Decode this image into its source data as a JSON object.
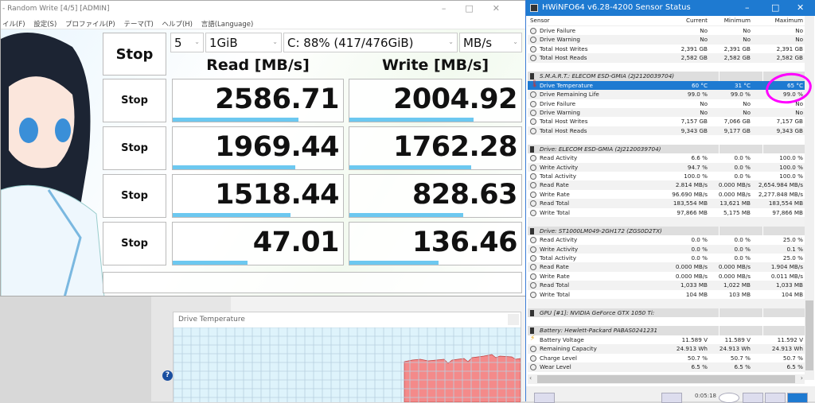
{
  "cdm": {
    "title": "- Random Write [4/5] [ADMIN]",
    "window_controls": [
      "–",
      "□",
      "✕"
    ],
    "menu": [
      "イル(F)",
      "設定(S)",
      "プロファイル(P)",
      "テーマ(T)",
      "ヘルプ(H)",
      "言語(Language)"
    ],
    "all_button": "Stop",
    "count": "5",
    "size": "1GiB",
    "drive": "C: 88% (417/476GiB)",
    "unit": "MB/s",
    "read_header": "Read [MB/s]",
    "write_header": "Write [MB/s]",
    "rows": [
      {
        "button": "Stop",
        "read": "2586.71",
        "write": "2004.92",
        "read_fill": 0.74,
        "write_fill": 0.72
      },
      {
        "button": "Stop",
        "read": "1969.44",
        "write": "1762.28",
        "read_fill": 0.72,
        "write_fill": 0.71
      },
      {
        "button": "Stop",
        "read": "1518.44",
        "write": "828.63",
        "read_fill": 0.69,
        "write_fill": 0.66
      },
      {
        "button": "Stop",
        "read": "47.01",
        "write": "136.46",
        "read_fill": 0.44,
        "write_fill": 0.52
      }
    ],
    "comment": ""
  },
  "temp_window": {
    "title": "Drive Temperature",
    "fill_color": "#f48a8a",
    "grid_color": "#b8d0e0",
    "bg_color": "#def3fb"
  },
  "hwinfo": {
    "title": "HWiNFO64 v6.28-4200 Sensor Status",
    "accent": "#1e7ad1",
    "highlight_color": "#ff00ff",
    "columns": [
      "Sensor",
      "Current",
      "Minimum",
      "Maximum"
    ],
    "rows": [
      {
        "type": "data",
        "name": "Drive Failure",
        "cur": "No",
        "min": "No",
        "max": "No"
      },
      {
        "type": "data",
        "name": "Drive Warning",
        "cur": "No",
        "min": "No",
        "max": "No"
      },
      {
        "type": "data",
        "name": "Total Host Writes",
        "cur": "2,391 GB",
        "min": "2,391 GB",
        "max": "2,391 GB"
      },
      {
        "type": "data",
        "name": "Total Host Reads",
        "cur": "2,582 GB",
        "min": "2,582 GB",
        "max": "2,582 GB"
      },
      {
        "type": "blank"
      },
      {
        "type": "group",
        "name": "S.M.A.R.T.: ELECOM ESD-GMIA (2J2120039704)"
      },
      {
        "type": "sel",
        "name": "Drive Temperature",
        "cur": "60 °C",
        "min": "31 °C",
        "max": "65 °C"
      },
      {
        "type": "data",
        "name": "Drive Remaining Life",
        "cur": "99.0 %",
        "min": "99.0 %",
        "max": "99.0 %"
      },
      {
        "type": "data",
        "name": "Drive Failure",
        "cur": "No",
        "min": "No",
        "max": "No"
      },
      {
        "type": "data",
        "name": "Drive Warning",
        "cur": "No",
        "min": "No",
        "max": "No"
      },
      {
        "type": "data",
        "name": "Total Host Writes",
        "cur": "7,157 GB",
        "min": "7,066 GB",
        "max": "7,157 GB"
      },
      {
        "type": "data",
        "name": "Total Host Reads",
        "cur": "9,343 GB",
        "min": "9,177 GB",
        "max": "9,343 GB"
      },
      {
        "type": "blank"
      },
      {
        "type": "group",
        "name": "Drive: ELECOM ESD-GMIA (2J2120039704)"
      },
      {
        "type": "data",
        "name": "Read Activity",
        "cur": "6.6 %",
        "min": "0.0 %",
        "max": "100.0 %"
      },
      {
        "type": "data",
        "name": "Write Activity",
        "cur": "94.7 %",
        "min": "0.0 %",
        "max": "100.0 %"
      },
      {
        "type": "data",
        "name": "Total Activity",
        "cur": "100.0 %",
        "min": "0.0 %",
        "max": "100.0 %"
      },
      {
        "type": "data",
        "name": "Read Rate",
        "cur": "2.814 MB/s",
        "min": "0.000 MB/s",
        "max": "2,654.984 MB/s"
      },
      {
        "type": "data",
        "name": "Write Rate",
        "cur": "96.690 MB/s",
        "min": "0.000 MB/s",
        "max": "2,277.848 MB/s"
      },
      {
        "type": "data",
        "name": "Read Total",
        "cur": "183,554 MB",
        "min": "13,621 MB",
        "max": "183,554 MB"
      },
      {
        "type": "data",
        "name": "Write Total",
        "cur": "97,866 MB",
        "min": "5,175 MB",
        "max": "97,866 MB"
      },
      {
        "type": "blank"
      },
      {
        "type": "group",
        "name": "Drive: ST1000LM049-2GH172 (ZGS0D2TX)"
      },
      {
        "type": "data",
        "name": "Read Activity",
        "cur": "0.0 %",
        "min": "0.0 %",
        "max": "25.0 %"
      },
      {
        "type": "data",
        "name": "Write Activity",
        "cur": "0.0 %",
        "min": "0.0 %",
        "max": "0.1 %"
      },
      {
        "type": "data",
        "name": "Total Activity",
        "cur": "0.0 %",
        "min": "0.0 %",
        "max": "25.0 %"
      },
      {
        "type": "data",
        "name": "Read Rate",
        "cur": "0.000 MB/s",
        "min": "0.000 MB/s",
        "max": "1.904 MB/s"
      },
      {
        "type": "data",
        "name": "Write Rate",
        "cur": "0.000 MB/s",
        "min": "0.000 MB/s",
        "max": "0.011 MB/s"
      },
      {
        "type": "data",
        "name": "Read Total",
        "cur": "1,033 MB",
        "min": "1,022 MB",
        "max": "1,033 MB"
      },
      {
        "type": "data",
        "name": "Write Total",
        "cur": "104 MB",
        "min": "103 MB",
        "max": "104 MB"
      },
      {
        "type": "blank"
      },
      {
        "type": "group",
        "name": "GPU [#1]: NVIDIA GeForce GTX 1050 Ti:"
      },
      {
        "type": "blank"
      },
      {
        "type": "group",
        "name": "Battery: Hewlett-Packard  PABAS0241231"
      },
      {
        "type": "bat",
        "name": "Battery Voltage",
        "cur": "11.589 V",
        "min": "11.589 V",
        "max": "11.592 V"
      },
      {
        "type": "data",
        "name": "Remaining Capacity",
        "cur": "24.913 Wh",
        "min": "24.913 Wh",
        "max": "24.913 Wh"
      },
      {
        "type": "data",
        "name": "Charge Level",
        "cur": "50.7 %",
        "min": "50.7 %",
        "max": "50.7 %"
      },
      {
        "type": "data",
        "name": "Wear Level",
        "cur": "6.5 %",
        "min": "6.5 %",
        "max": "6.5 %"
      }
    ],
    "clock": "0:05:18"
  }
}
